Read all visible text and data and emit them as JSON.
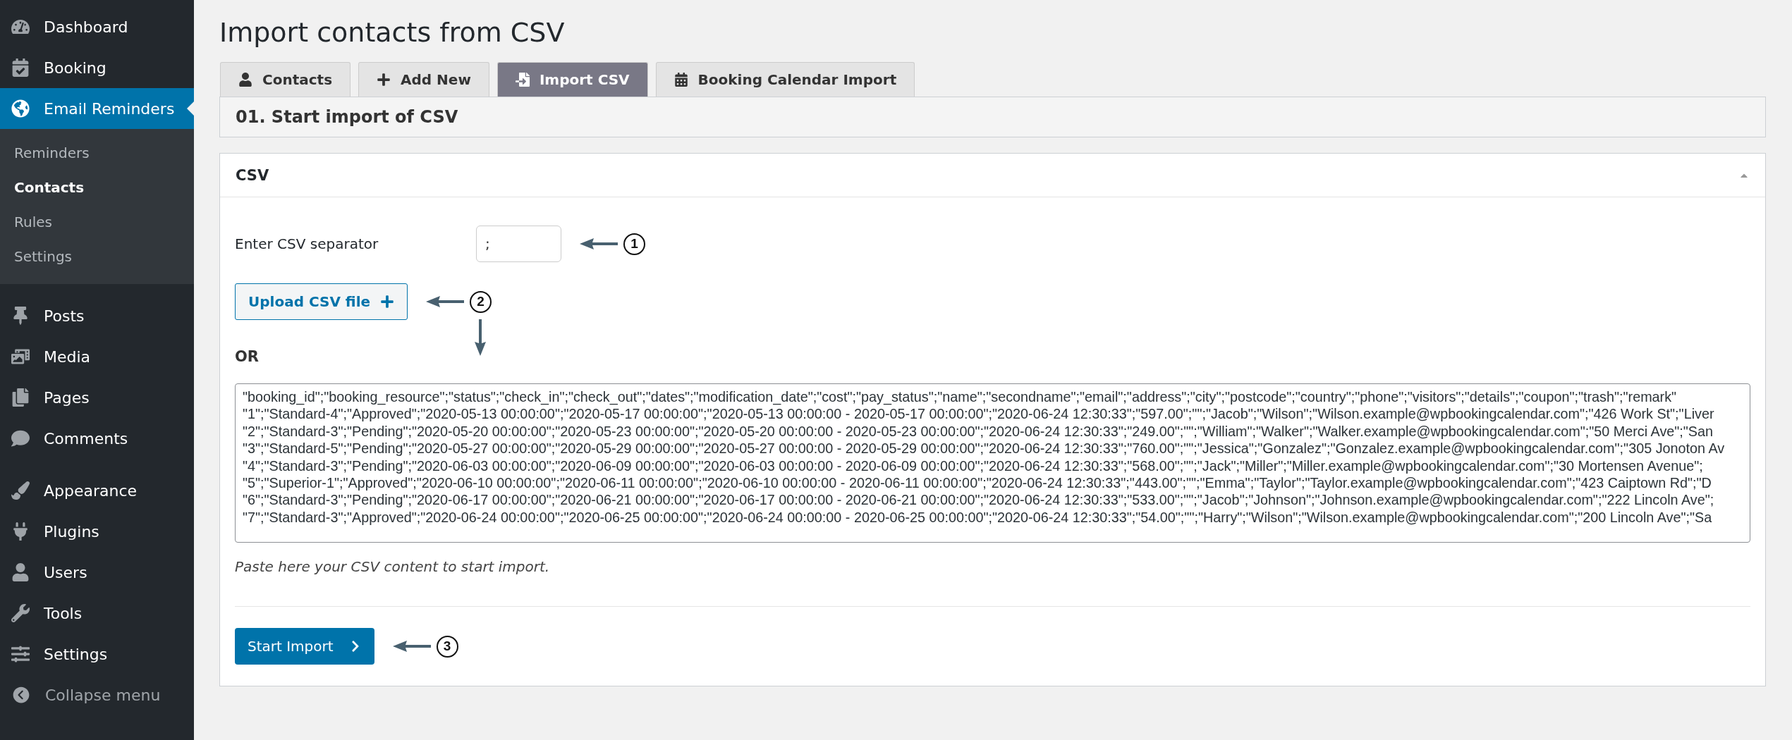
{
  "sidebar": {
    "groups": [
      [
        {
          "label": "Dashboard",
          "selected": false
        },
        {
          "label": "Booking",
          "selected": false
        },
        {
          "label": "Email Reminders",
          "selected": true,
          "children": [
            {
              "label": "Reminders",
              "selected": false
            },
            {
              "label": "Contacts",
              "selected": true
            },
            {
              "label": "Rules",
              "selected": false
            },
            {
              "label": "Settings",
              "selected": false
            }
          ]
        }
      ],
      [
        {
          "label": "Posts",
          "selected": false
        },
        {
          "label": "Media",
          "selected": false
        },
        {
          "label": "Pages",
          "selected": false
        },
        {
          "label": "Comments",
          "selected": false
        }
      ],
      [
        {
          "label": "Appearance",
          "selected": false
        },
        {
          "label": "Plugins",
          "selected": false
        },
        {
          "label": "Users",
          "selected": false
        },
        {
          "label": "Tools",
          "selected": false
        },
        {
          "label": "Settings",
          "selected": false
        }
      ]
    ],
    "collapse": "Collapse menu"
  },
  "page_title": "Import contacts from CSV",
  "tabs": [
    {
      "label": "Contacts",
      "selected": false
    },
    {
      "label": "Add New",
      "selected": false
    },
    {
      "label": "Import CSV",
      "selected": true
    },
    {
      "label": "Booking Calendar Import",
      "selected": false
    }
  ],
  "section_title": "01. Start import of CSV",
  "panel": {
    "title": "CSV",
    "expanded": true,
    "separator": {
      "label": "Enter CSV separator",
      "value": ";",
      "callout": "1"
    },
    "upload": {
      "label": "Upload CSV file",
      "callout": "2"
    },
    "or": "OR",
    "csv_lines": [
      "\"booking_id\";\"booking_resource\";\"status\";\"check_in\";\"check_out\";\"dates\";\"modification_date\";\"cost\";\"pay_status\";\"name\";\"secondname\";\"email\";\"address\";\"city\";\"postcode\";\"country\";\"phone\";\"visitors\";\"details\";\"coupon\";\"trash\";\"remark\"",
      "\"1\";\"Standard-4\";\"Approved\";\"2020-05-13 00:00:00\";\"2020-05-17 00:00:00\";\"2020-05-13 00:00:00 - 2020-05-17 00:00:00\";\"2020-06-24 12:30:33\";\"597.00\";\"\";\"Jacob\";\"Wilson\";\"Wilson.example@wpbookingcalendar.com\";\"426 Work St\";\"Liver",
      "\"2\";\"Standard-3\";\"Pending\";\"2020-05-20 00:00:00\";\"2020-05-23 00:00:00\";\"2020-05-20 00:00:00 - 2020-05-23 00:00:00\";\"2020-06-24 12:30:33\";\"249.00\";\"\";\"William\";\"Walker\";\"Walker.example@wpbookingcalendar.com\";\"50 Merci Ave\";\"San",
      "\"3\";\"Standard-5\";\"Pending\";\"2020-05-27 00:00:00\";\"2020-05-29 00:00:00\";\"2020-05-27 00:00:00 - 2020-05-29 00:00:00\";\"2020-06-24 12:30:33\";\"760.00\";\"\";\"Jessica\";\"Gonzalez\";\"Gonzalez.example@wpbookingcalendar.com\";\"305 Jonoton Av",
      "\"4\";\"Standard-3\";\"Pending\";\"2020-06-03 00:00:00\";\"2020-06-09 00:00:00\";\"2020-06-03 00:00:00 - 2020-06-09 00:00:00\";\"2020-06-24 12:30:33\";\"568.00\";\"\";\"Jack\";\"Miller\";\"Miller.example@wpbookingcalendar.com\";\"30 Mortensen Avenue\";",
      "\"5\";\"Superior-1\";\"Approved\";\"2020-06-10 00:00:00\";\"2020-06-11 00:00:00\";\"2020-06-10 00:00:00 - 2020-06-11 00:00:00\";\"2020-06-24 12:30:33\";\"443.00\";\"\";\"Emma\";\"Taylor\";\"Taylor.example@wpbookingcalendar.com\";\"423 Caiptown Rd\";\"D",
      "\"6\";\"Standard-3\";\"Pending\";\"2020-06-17 00:00:00\";\"2020-06-21 00:00:00\";\"2020-06-17 00:00:00 - 2020-06-21 00:00:00\";\"2020-06-24 12:30:33\";\"533.00\";\"\";\"Jacob\";\"Johnson\";\"Johnson.example@wpbookingcalendar.com\";\"222 Lincoln Ave\";",
      "\"7\";\"Standard-3\";\"Approved\";\"2020-06-24 00:00:00\";\"2020-06-25 00:00:00\";\"2020-06-24 00:00:00 - 2020-06-25 00:00:00\";\"2020-06-24 12:30:33\";\"54.00\";\"\";\"Harry\";\"Wilson\";\"Wilson.example@wpbookingcalendar.com\";\"200 Lincoln Ave\";\"Sa"
    ],
    "hint": "Paste here your CSV content to start import.",
    "start": {
      "label": "Start Import",
      "callout": "3"
    }
  }
}
